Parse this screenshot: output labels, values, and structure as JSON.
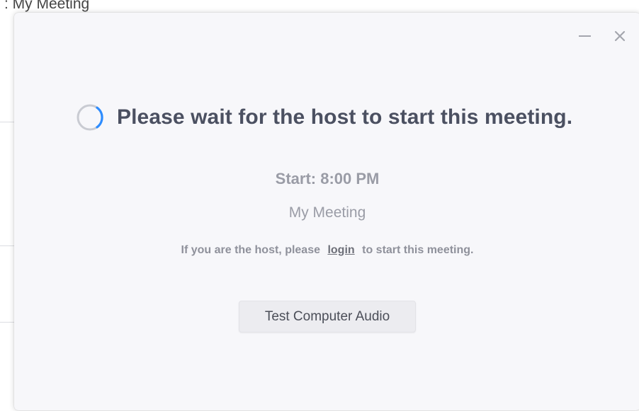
{
  "background_window": {
    "title": "My Meeting"
  },
  "dialog": {
    "heading": "Please wait for the host to start this meeting.",
    "start_time": "Start: 8:00 PM",
    "meeting_name": "My Meeting",
    "host_prompt_before": "If you are the host, please",
    "login_link": "login",
    "host_prompt_after": "to start this meeting.",
    "test_audio_button": "Test Computer Audio",
    "icons": {
      "minimize": "minimize-icon",
      "close": "close-icon",
      "spinner": "loading-spinner-icon"
    },
    "colors": {
      "spinner_accent": "#2d8cff",
      "heading": "#4b5061",
      "secondary_text": "#9a9ca6"
    }
  }
}
